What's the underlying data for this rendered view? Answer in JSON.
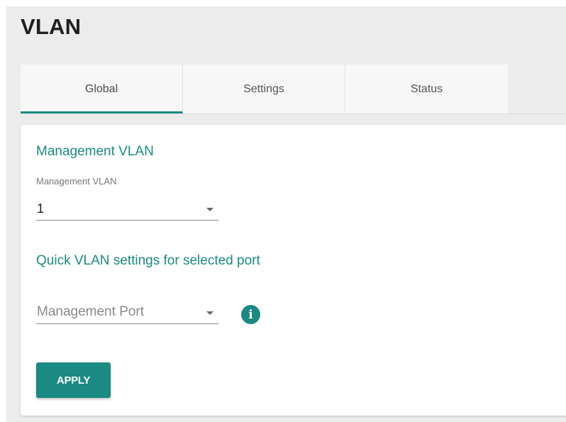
{
  "header": {
    "title": "VLAN"
  },
  "tabs": [
    {
      "label": "Global",
      "active": true
    },
    {
      "label": "Settings",
      "active": false
    },
    {
      "label": "Status",
      "active": false
    }
  ],
  "management_vlan": {
    "section_title": "Management VLAN",
    "field_label": "Management VLAN",
    "selected_value": "1"
  },
  "quick_vlan": {
    "section_title": "Quick VLAN settings for selected port",
    "port_placeholder": "Management Port",
    "info_icon": "info-icon"
  },
  "actions": {
    "apply_label": "APPLY"
  },
  "colors": {
    "accent": "#1a8a82",
    "page_background": "#ececec",
    "card_background": "#ffffff"
  }
}
